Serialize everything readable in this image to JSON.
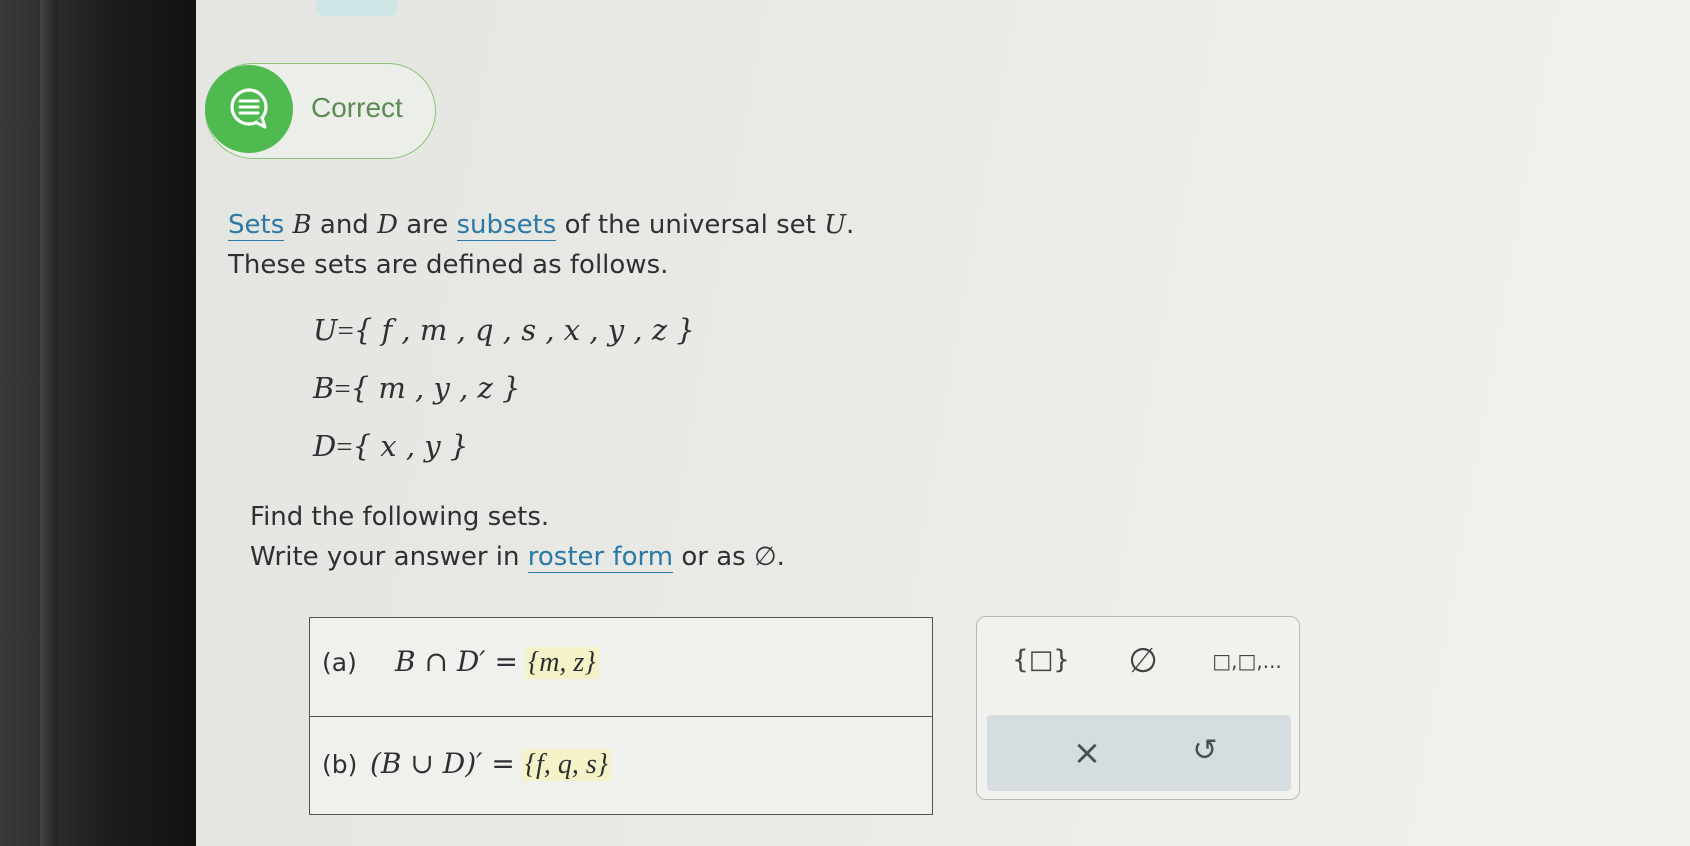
{
  "status": {
    "label": "Correct",
    "icon": "chat-bubble-icon"
  },
  "intro": {
    "word_sets": "Sets",
    "set_b": "B",
    "and": " and ",
    "set_d": "D",
    "are": " are ",
    "word_subsets": "subsets",
    "of_universal": " of the universal set ",
    "set_u": "U",
    "period": ".",
    "line2": "These sets are defined as follows."
  },
  "definitions": [
    {
      "lhs": "U",
      "rhs": "{ f , m , q , s , x , y , z }"
    },
    {
      "lhs": "B",
      "rhs": "{ m , y , z }"
    },
    {
      "lhs": "D",
      "rhs": "{ x , y }"
    }
  ],
  "instructions": {
    "line1": "Find the following sets.",
    "write_prefix": "Write your answer in ",
    "roster_link": "roster form",
    "or_as": " or as ",
    "empty_symbol": "∅",
    "end": "."
  },
  "answers": [
    {
      "label": "(a)",
      "expr": "B ∩ D′ =",
      "value": "{m, z}"
    },
    {
      "label": "(b)",
      "expr": "(B ∪ D)′ =",
      "value": "{f, q, s}"
    }
  ],
  "keypad": {
    "set_button": "{□}",
    "empty_button": "∅",
    "list_button": "□,□,...",
    "clear_button": "×",
    "undo_button": "↺"
  }
}
